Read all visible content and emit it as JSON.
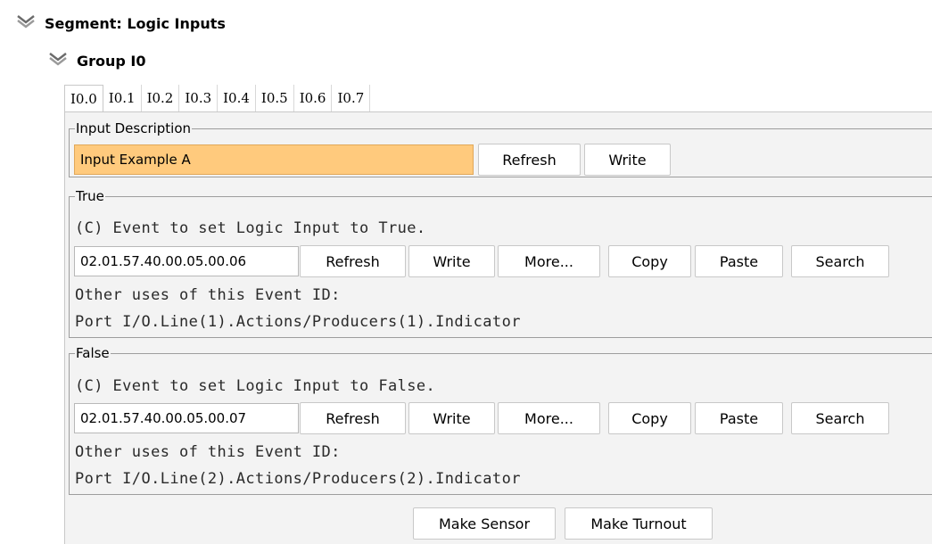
{
  "segment": {
    "title": "Segment: Logic Inputs",
    "icon": "double-chevron-down-icon"
  },
  "group": {
    "title": "Group I0",
    "icon": "double-chevron-down-icon"
  },
  "tabs": [
    "I0.0",
    "I0.1",
    "I0.2",
    "I0.3",
    "I0.4",
    "I0.5",
    "I0.6",
    "I0.7"
  ],
  "active_tab": "I0.0",
  "input_description": {
    "legend": "Input Description",
    "value": "Input Example A",
    "refresh_label": "Refresh",
    "write_label": "Write"
  },
  "true_section": {
    "legend": "True",
    "description": "(C) Event to set Logic Input to True.",
    "event_id": "02.01.57.40.00.05.00.06",
    "buttons": {
      "refresh": "Refresh",
      "write": "Write",
      "more": "More...",
      "copy": "Copy",
      "paste": "Paste",
      "search": "Search"
    },
    "other_uses_label": "Other uses of this Event ID:",
    "other_uses_value": "Port I/O.Line(1).Actions/Producers(1).Indicator"
  },
  "false_section": {
    "legend": "False",
    "description": "(C) Event to set Logic Input to False.",
    "event_id": "02.01.57.40.00.05.00.07",
    "buttons": {
      "refresh": "Refresh",
      "write": "Write",
      "more": "More...",
      "copy": "Copy",
      "paste": "Paste",
      "search": "Search"
    },
    "other_uses_label": "Other uses of this Event ID:",
    "other_uses_value": "Port I/O.Line(2).Actions/Producers(2).Indicator"
  },
  "bottom_buttons": {
    "make_sensor": "Make Sensor",
    "make_turnout": "Make Turnout"
  },
  "colors": {
    "description_field": "#ffca7d",
    "panel_background": "#f3f3f3"
  }
}
